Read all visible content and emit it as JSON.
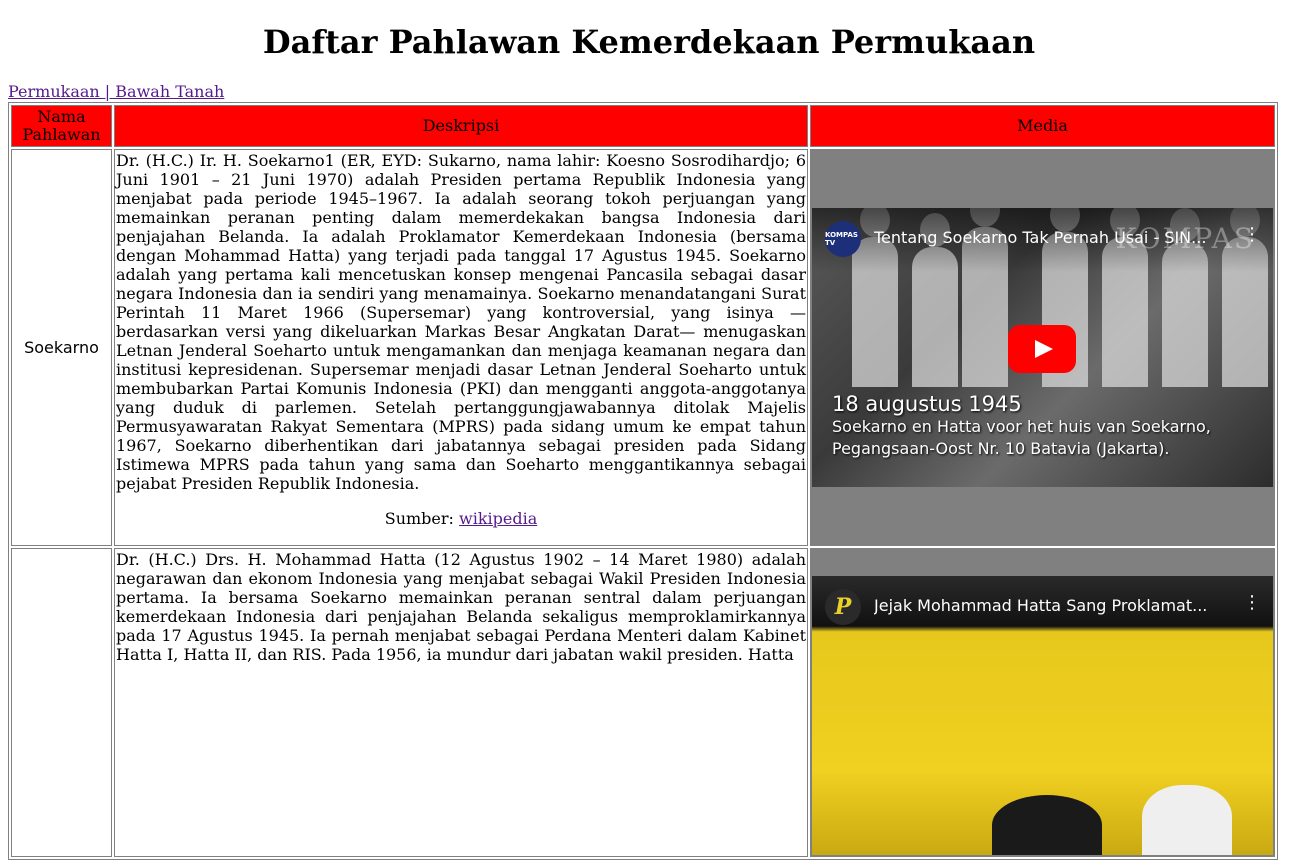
{
  "page": {
    "title": "Daftar Pahlawan Kemerdekaan Permukaan",
    "nav_link": "Permukaan | Bawah Tanah"
  },
  "table": {
    "headers": [
      "Nama Pahlawan",
      "Deskripsi",
      "Media"
    ],
    "rows": [
      {
        "name": "Soekarno",
        "description": "Dr. (H.C.) Ir. H. Soekarno1 (ER, EYD: Sukarno, nama lahir: Koesno Sosrodihardjo; 6 Juni 1901 – 21 Juni 1970) adalah Presiden pertama Republik Indonesia yang menjabat pada periode 1945–1967. Ia adalah seorang tokoh perjuangan yang memainkan peranan penting dalam memerdekakan bangsa Indonesia dari penjajahan Belanda. Ia adalah Proklamator Kemerdekaan Indonesia (bersama dengan Mohammad Hatta) yang terjadi pada tanggal 17 Agustus 1945. Soekarno adalah yang pertama kali mencetuskan konsep mengenai Pancasila sebagai dasar negara Indonesia dan ia sendiri yang menamainya. Soekarno menandatangani Surat Perintah 11 Maret 1966 (Supersemar) yang kontroversial, yang isinya —berdasarkan versi yang dikeluarkan Markas Besar Angkatan Darat— menugaskan Letnan Jenderal Soeharto untuk mengamankan dan menjaga keamanan negara dan institusi kepresidenan. Supersemar menjadi dasar Letnan Jenderal Soeharto untuk membubarkan Partai Komunis Indonesia (PKI) dan mengganti anggota-anggotanya yang duduk di parlemen. Setelah pertanggungjawabannya ditolak Majelis Permusyawaratan Rakyat Sementara (MPRS) pada sidang umum ke empat tahun 1967, Soekarno diberhentikan dari jabatannya sebagai presiden pada Sidang Istimewa MPRS pada tahun yang sama dan Soeharto menggantikannya sebagai pejabat Presiden Republik Indonesia.",
        "source_label": "Sumber:",
        "source_link": "wikipedia",
        "video": {
          "title": "Tentang Soekarno Tak Pernah Usai - SIN...",
          "channel_badge": "KOMPAS TV",
          "watermark": "KOMPAS",
          "caption_line1": "18 augustus 1945",
          "caption_line2": "Soekarno en Hatta voor het huis van Soekarno,",
          "caption_line3": "Pegangsaan-Oost Nr. 10 Batavia (Jakarta)."
        }
      },
      {
        "name": "",
        "description": "Dr. (H.C.) Drs. H. Mohammad Hatta (12 Agustus 1902 – 14 Maret 1980) adalah negarawan dan ekonom Indonesia yang menjabat sebagai Wakil Presiden Indonesia pertama. Ia bersama Soekarno memainkan peranan sentral dalam perjuangan kemerdekaan Indonesia dari penjajahan Belanda sekaligus memproklamirkannya pada 17 Agustus 1945. Ia pernah menjabat sebagai Perdana Menteri dalam Kabinet Hatta I, Hatta II, dan RIS. Pada 1956, ia mundur dari jabatan wakil presiden. Hatta",
        "video": {
          "title": "Jejak Mohammad Hatta Sang Proklamat...",
          "channel_badge": "P"
        }
      }
    ]
  },
  "colors": {
    "header_bg": "#ff0000",
    "media_bg": "#808080",
    "link": "#551a8b",
    "play_button": "#ff0000"
  },
  "icons": [
    "play-icon",
    "more-vertical-icon",
    "channel-avatar-icon"
  ]
}
